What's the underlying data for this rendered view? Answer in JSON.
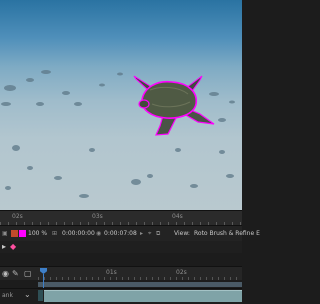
{
  "viewer": {
    "ruler_labels": [
      "02s",
      "03s",
      "04s"
    ]
  },
  "viewer_bar": {
    "zoom_swatch_color": "#ff00ff",
    "zoom": "100 %",
    "timecode": "0:00:00:00",
    "duration": "0:00:07:08",
    "view_label": "View:",
    "view_value": "Roto Brush & Refine E"
  },
  "timeline": {
    "ruler_labels": [
      "01s",
      "02s"
    ],
    "layer_label": "ank",
    "icons": [
      "eye-icon",
      "pen-icon",
      "layer-icon",
      "graph-icon"
    ]
  },
  "colors": {
    "roto_outline": "#ff00ff",
    "cti": "#3e7fc8",
    "layer_bar": "#7fa3a7"
  }
}
